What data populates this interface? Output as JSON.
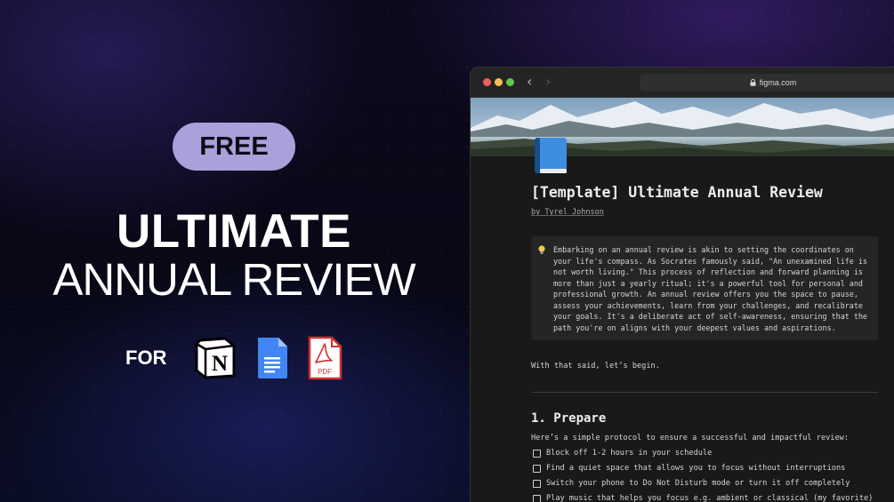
{
  "hero": {
    "badge": "FREE",
    "title_main": "ULTIMATE",
    "title_sub": "ANNUAL REVIEW",
    "for_label": "FOR",
    "apps": [
      {
        "name": "notion-icon"
      },
      {
        "name": "google-docs-icon"
      },
      {
        "name": "pdf-icon",
        "label": "PDF"
      }
    ],
    "notion_glyph": "N"
  },
  "browser": {
    "url": "figma.com"
  },
  "document": {
    "title": "[Template] Ultimate Annual Review",
    "author": "by Tyrel Johnson",
    "callout_text": "Embarking on an annual review is akin to setting the coordinates on\nyour life's compass. As Socrates famously said, \"An unexamined life is\nnot worth living.\" This process of reflection and forward planning is\nmore than just a yearly ritual; it's a powerful tool for personal and\nprofessional growth. An annual review offers you the space to pause,\nassess your achievements, learn from your challenges, and recalibrate\nyour goals. It's a deliberate act of self-awareness, ensuring that the\npath you're on aligns with your deepest values and aspirations.",
    "intro": "With that said, let’s begin.",
    "section_heading": "1. Prepare",
    "protocol_text": "Here’s a simple protocol to ensure a successful and impactful review:",
    "todos": [
      "Block off 1-2 hours in your schedule",
      "Find a quiet space that allows you to focus without interruptions",
      "Switch your phone to Do Not Disturb mode or turn it off completely",
      "Play music that helps you focus e.g. ambient or classical (my favorite)"
    ]
  },
  "colors": {
    "badge_bg": "#a9a1d9",
    "page_bg": "#191919",
    "callout_bg": "#252525"
  }
}
